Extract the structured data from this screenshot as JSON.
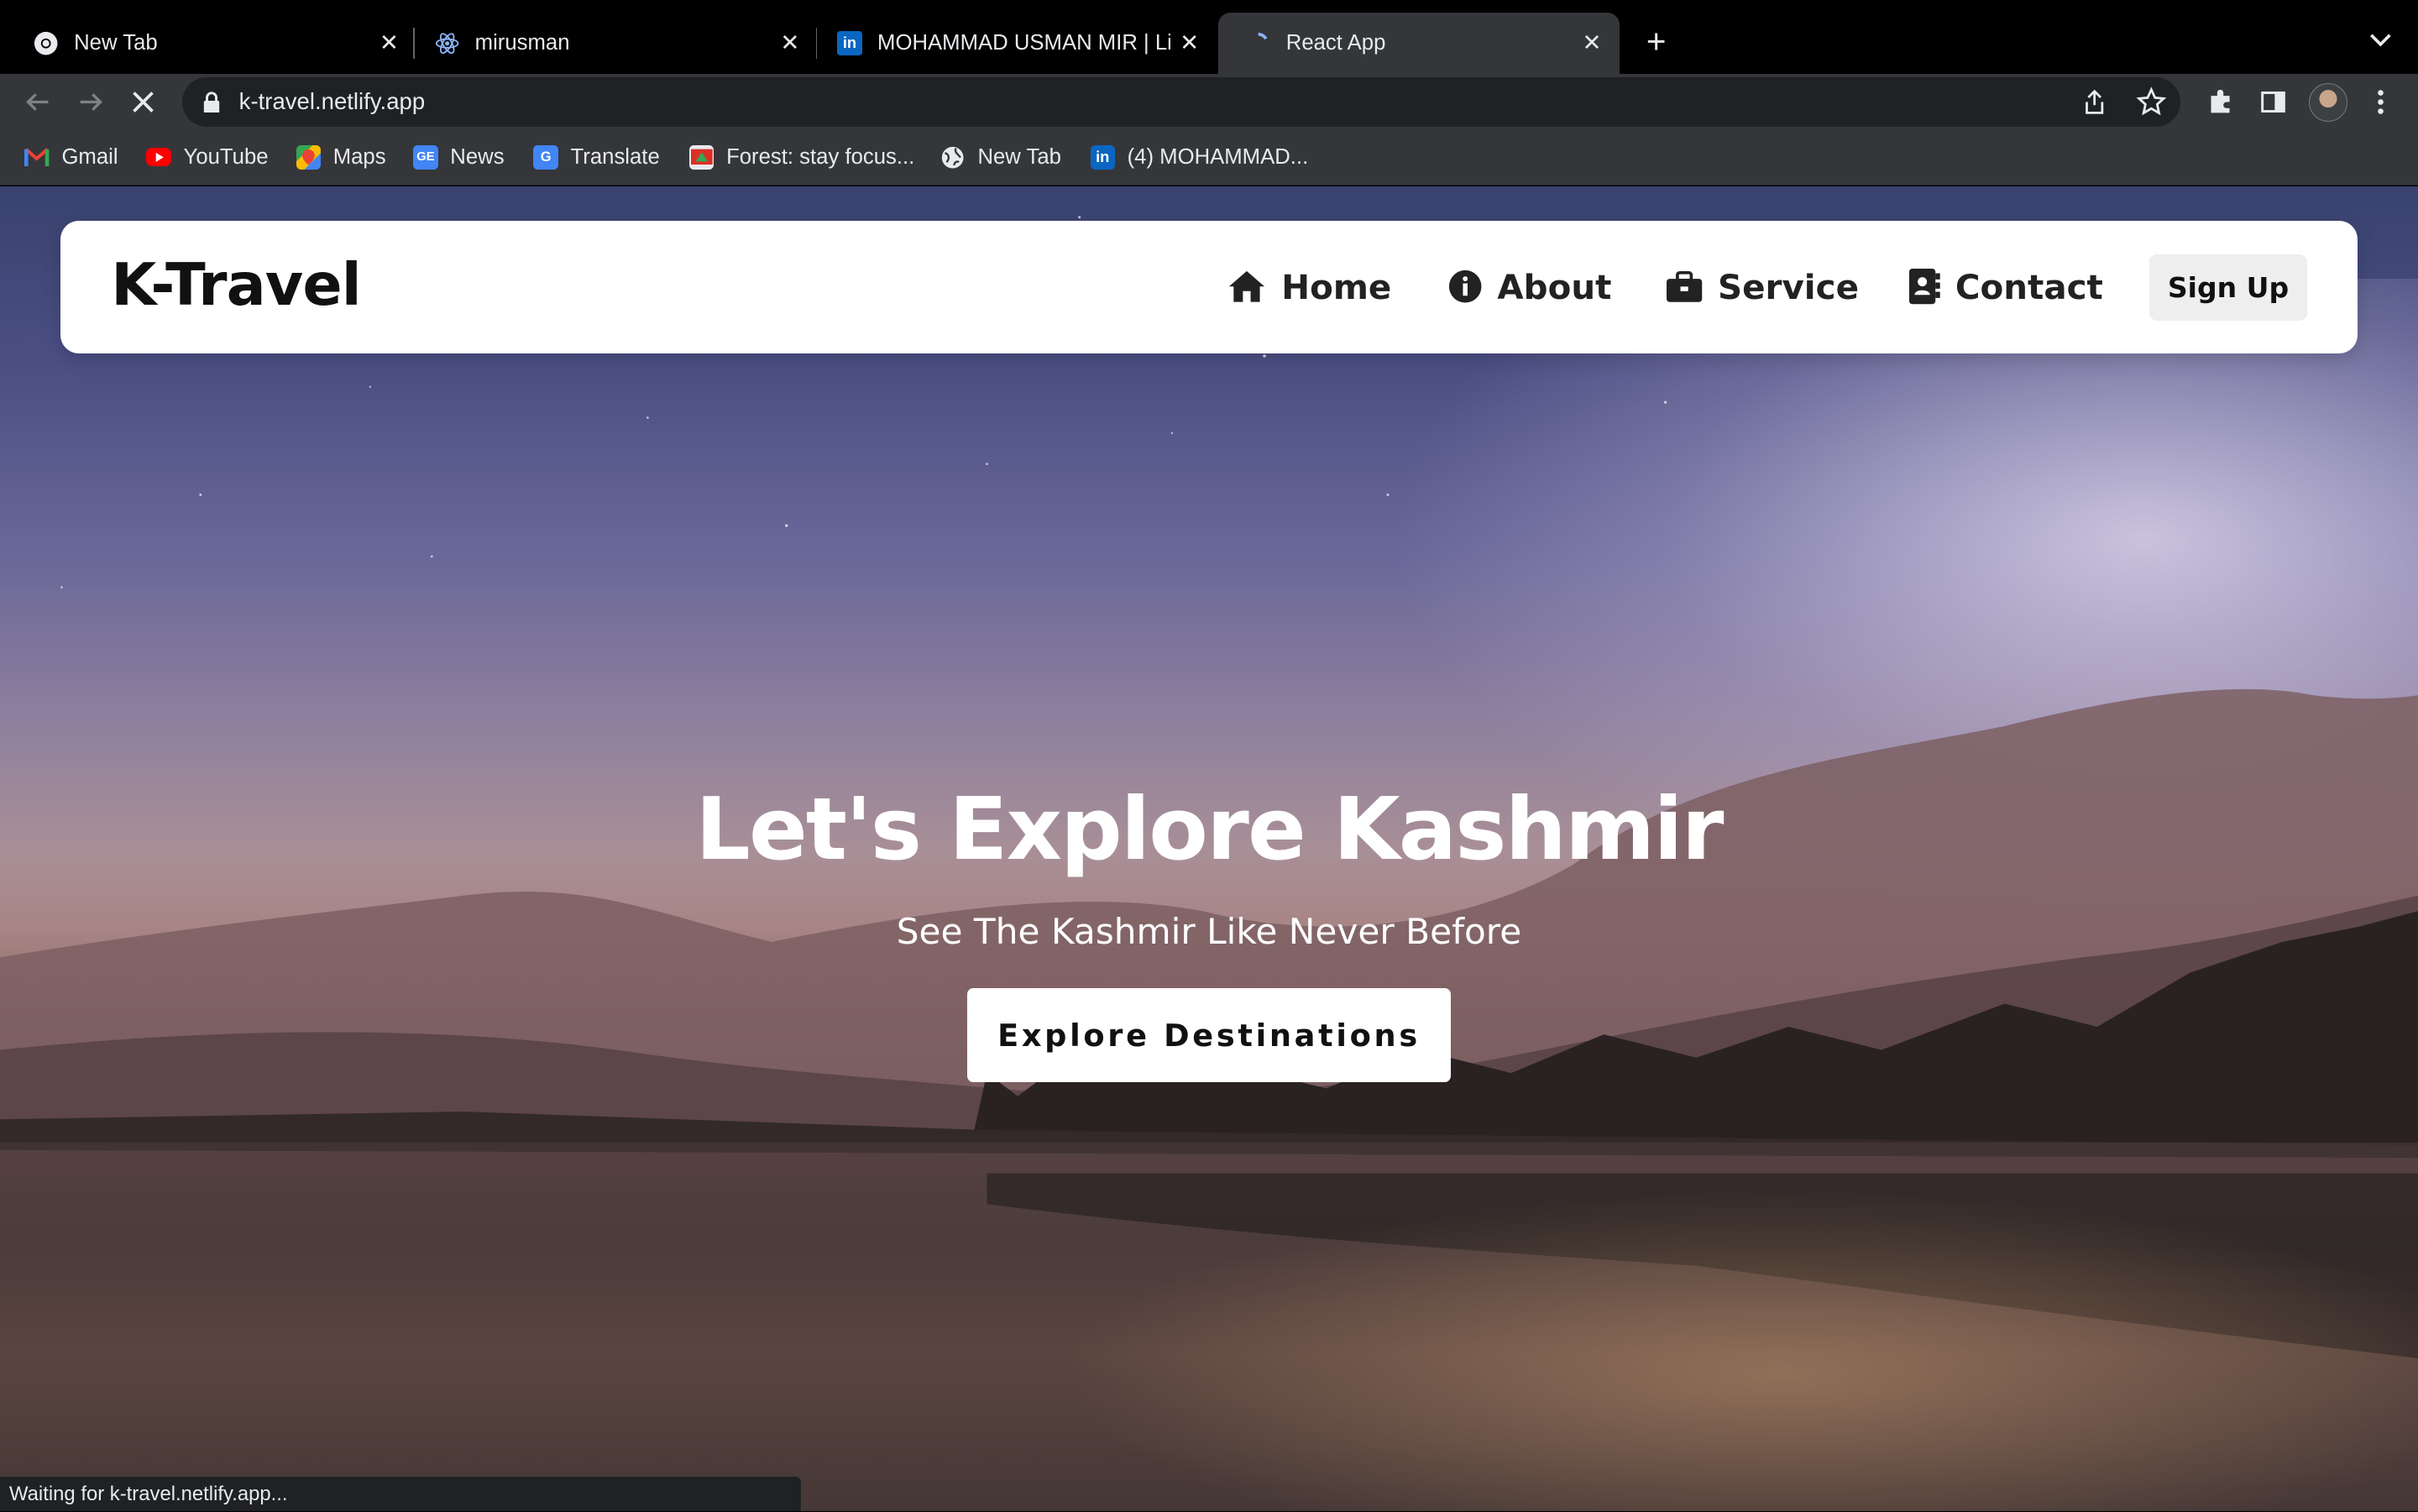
{
  "browser": {
    "tabs": [
      {
        "title": "New Tab",
        "active": false
      },
      {
        "title": "mirusman",
        "active": false
      },
      {
        "title": "MOHAMMAD USMAN MIR | Lin",
        "active": false
      },
      {
        "title": "React App",
        "active": true
      }
    ],
    "url": "k-travel.netlify.app",
    "bookmarks": [
      {
        "label": "Gmail",
        "icon": "gmail-icon"
      },
      {
        "label": "YouTube",
        "icon": "youtube-icon"
      },
      {
        "label": "Maps",
        "icon": "maps-icon"
      },
      {
        "label": "News",
        "icon": "news-icon"
      },
      {
        "label": "Translate",
        "icon": "translate-icon"
      },
      {
        "label": "Forest: stay focus...",
        "icon": "forest-icon"
      },
      {
        "label": "New Tab",
        "icon": "globe-icon"
      },
      {
        "label": "(4) MOHAMMAD...",
        "icon": "linkedin-icon"
      }
    ],
    "status_text": "Waiting for k-travel.netlify.app..."
  },
  "site": {
    "brand": "K-Travel",
    "nav": {
      "home": "Home",
      "about": "About",
      "service": "Service",
      "contact": "Contact",
      "signup": "Sign Up"
    },
    "hero": {
      "title": "Let's Explore Kashmir",
      "subtitle": "See The Kashmir Like Never Before",
      "button": "Explore Destinations"
    }
  },
  "colors": {
    "chrome_dark": "#35363a",
    "tab_strip": "#000000",
    "navbar_bg": "#ffffff",
    "signup_bg": "#eeeeee"
  }
}
